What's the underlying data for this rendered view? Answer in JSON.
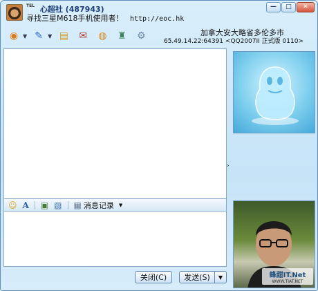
{
  "contact": {
    "tel_badge": "TEL",
    "nick": "心超社",
    "qq_number": "(487943)",
    "signature": "寻找三星M618手机使用者！",
    "signature_url": "http://eoc.hk",
    "location": "加拿大安大略省多伦多市",
    "ip_version": "65.49.14.22:64391 <QQ2007II 正式版 0110>"
  },
  "window_controls": {
    "minimize": "—",
    "maximize": "□",
    "close": "✕"
  },
  "toolbar": {
    "items": [
      {
        "name": "video-chat-icon",
        "glyph": "◉",
        "color": "#e07a12",
        "has_dropdown": true
      },
      {
        "name": "voice-chat-icon",
        "glyph": "✎",
        "color": "#2f6fc1",
        "has_dropdown": true
      },
      {
        "name": "send-file-icon",
        "glyph": "▤",
        "color": "#d69b22",
        "has_dropdown": false
      },
      {
        "name": "send-sms-icon",
        "glyph": "✉",
        "color": "#b53a2a",
        "has_dropdown": false
      },
      {
        "name": "group-chat-icon",
        "glyph": "◍",
        "color": "#d68a1a",
        "has_dropdown": false
      },
      {
        "name": "remote-assist-icon",
        "glyph": "♜",
        "color": "#3f7f5a",
        "has_dropdown": false
      },
      {
        "name": "settings-icon",
        "glyph": "⚙",
        "color": "#6c86a8",
        "has_dropdown": false
      }
    ]
  },
  "format_bar": {
    "history_label": "消息记录"
  },
  "buttons": {
    "close_label": "关闭(C)",
    "send_label": "发送(S)",
    "send_dropdown": "▼"
  },
  "watermark": {
    "main": "蜂甜IT.Net",
    "sub": "WWW.TIAT.NET"
  },
  "colors": {
    "accent": "#1a3e7a",
    "window_bg": "#c6e3f7"
  }
}
